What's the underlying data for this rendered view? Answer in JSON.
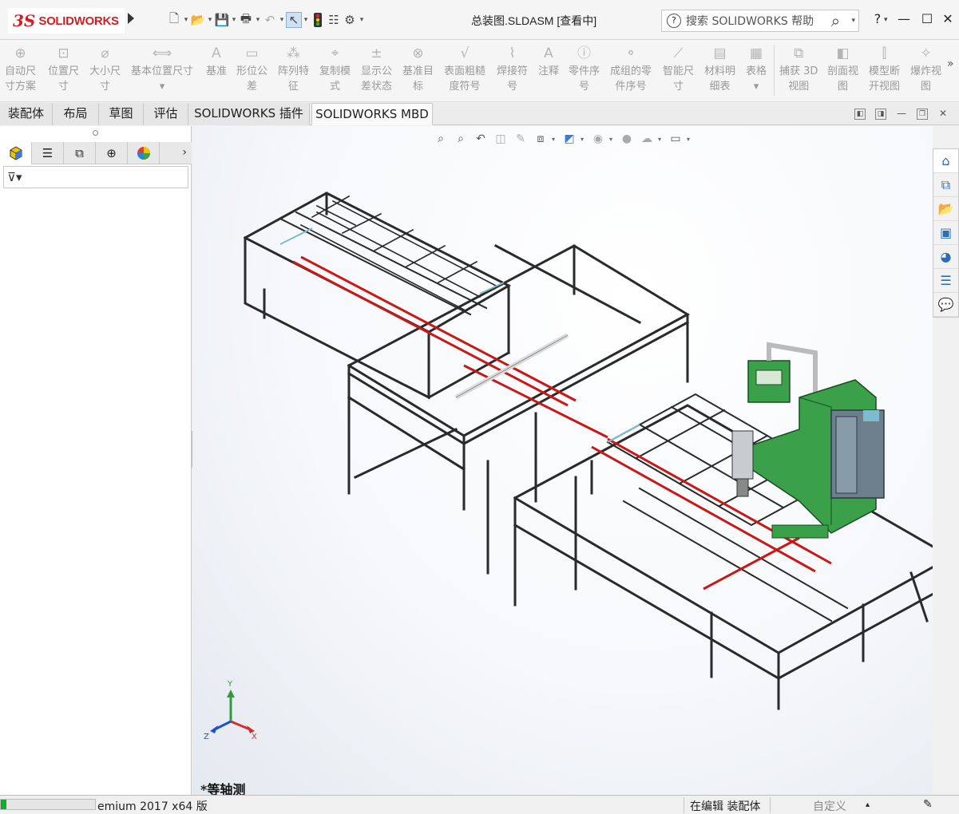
{
  "app": {
    "brand": "SOLIDWORKS",
    "brand_mark": "3S",
    "document_title": "总装图.SLDASM [查看中]"
  },
  "search": {
    "placeholder": "搜索 SOLIDWORKS 帮助",
    "help_mark": "?"
  },
  "window_buttons": [
    "?",
    "—",
    "☐",
    "✕"
  ],
  "quick_access": [
    {
      "icon": "new-document-icon",
      "glyph": "🗋"
    },
    {
      "icon": "open-folder-icon",
      "glyph": "📂"
    },
    {
      "icon": "save-icon",
      "glyph": "💾"
    },
    {
      "icon": "print-icon",
      "glyph": "🖶"
    },
    {
      "icon": "undo-icon",
      "glyph": "↶"
    },
    {
      "icon": "select-pointer-icon",
      "glyph": "↖"
    },
    {
      "icon": "rebuild-traffic-light-icon",
      "glyph": "🚦"
    },
    {
      "icon": "file-properties-icon",
      "glyph": "☷"
    },
    {
      "icon": "options-gear-icon",
      "glyph": "⚙"
    }
  ],
  "ribbon": {
    "items": [
      {
        "label_1": "自动尺",
        "label_2": "寸方案",
        "icon": "auto-dimension-icon",
        "glyph": "⊕"
      },
      {
        "label_1": "位置尺",
        "label_2": "寸",
        "icon": "location-dimension-icon",
        "glyph": "⊡"
      },
      {
        "label_1": "大小尺",
        "label_2": "寸",
        "icon": "size-dimension-icon",
        "glyph": "⌀"
      },
      {
        "label_1": "基本位置尺寸",
        "label_2": "▾",
        "icon": "basic-location-icon",
        "glyph": "⟺"
      },
      {
        "label_1": "基准",
        "label_2": "",
        "icon": "datum-icon",
        "glyph": "Ａ"
      },
      {
        "label_1": "形位公",
        "label_2": "差",
        "icon": "gtol-icon",
        "glyph": "▭"
      },
      {
        "label_1": "阵列特",
        "label_2": "征",
        "icon": "pattern-feature-icon",
        "glyph": "⁂"
      },
      {
        "label_1": "复制模",
        "label_2": "式",
        "icon": "copy-scheme-icon",
        "glyph": "⌖"
      },
      {
        "label_1": "显示公",
        "label_2": "差状态",
        "icon": "tolerance-status-icon",
        "glyph": "±"
      },
      {
        "label_1": "基准目",
        "label_2": "标",
        "icon": "datum-target-icon",
        "glyph": "⊗"
      },
      {
        "label_1": "表面粗糙",
        "label_2": "度符号",
        "icon": "surface-finish-icon",
        "glyph": "√"
      },
      {
        "label_1": "焊接符",
        "label_2": "号",
        "icon": "weld-symbol-icon",
        "glyph": "⌇"
      },
      {
        "label_1": "注释",
        "label_2": "",
        "icon": "note-icon",
        "glyph": "A"
      },
      {
        "label_1": "零件序",
        "label_2": "号",
        "icon": "balloon-icon",
        "glyph": "ⓘ"
      },
      {
        "label_1": "成组的零",
        "label_2": "件序号",
        "icon": "stacked-balloon-icon",
        "glyph": "⚬"
      },
      {
        "label_1": "智能尺",
        "label_2": "寸",
        "icon": "smart-dimension-icon",
        "glyph": "⟋"
      },
      {
        "label_1": "材料明",
        "label_2": "细表",
        "icon": "bom-icon",
        "glyph": "▤"
      },
      {
        "label_1": "表格",
        "label_2": "▾",
        "icon": "table-icon",
        "glyph": "▦"
      },
      {
        "label_1": "捕获 3D",
        "label_2": "视图",
        "icon": "capture-3d-view-icon",
        "glyph": "⧉"
      },
      {
        "label_1": "剖面视",
        "label_2": "图",
        "icon": "section-view-icon",
        "glyph": "◧"
      },
      {
        "label_1": "模型断",
        "label_2": "开视图",
        "icon": "model-break-view-icon",
        "glyph": "⫿"
      },
      {
        "label_1": "爆炸视",
        "label_2": "图",
        "icon": "exploded-view-icon",
        "glyph": "✧"
      }
    ],
    "more": "»"
  },
  "tabs": [
    "装配体",
    "布局",
    "草图",
    "评估",
    "SOLIDWORKS 插件",
    "SOLIDWORKS MBD"
  ],
  "active_tab": "SOLIDWORKS MBD",
  "panel_tabs": [
    {
      "icon": "feature-manager-icon",
      "glyph": "🧊"
    },
    {
      "icon": "property-manager-icon",
      "glyph": "☰"
    },
    {
      "icon": "configuration-manager-icon",
      "glyph": "⧉"
    },
    {
      "icon": "dimxpert-manager-icon",
      "glyph": "⊕"
    },
    {
      "icon": "display-manager-icon",
      "glyph": "◕"
    }
  ],
  "panel_more": "›",
  "filter": {
    "glyph": "⊽▾"
  },
  "view_hud": [
    {
      "icon": "zoom-to-fit-icon",
      "glyph": "⌕"
    },
    {
      "icon": "zoom-to-area-icon",
      "glyph": "⌕"
    },
    {
      "icon": "previous-view-icon",
      "glyph": "↶"
    },
    {
      "icon": "section-view-hud-icon",
      "glyph": "◫"
    },
    {
      "icon": "dynamic-annotation-icon",
      "glyph": "✎"
    },
    {
      "icon": "view-orientation-icon",
      "glyph": "⧈"
    },
    {
      "icon": "display-style-icon",
      "glyph": "◩"
    },
    {
      "icon": "hide-show-items-icon",
      "glyph": "◉"
    },
    {
      "icon": "edit-appearance-icon",
      "glyph": "●"
    },
    {
      "icon": "apply-scene-icon",
      "glyph": "☁"
    },
    {
      "icon": "view-settings-icon",
      "glyph": "▭"
    }
  ],
  "view_label": "*等轴测",
  "triad": {
    "x": "X",
    "y": "Y",
    "z": "Z"
  },
  "task_pane": [
    {
      "icon": "home-icon",
      "glyph": "⌂"
    },
    {
      "icon": "design-library-icon",
      "glyph": "⧉"
    },
    {
      "icon": "file-explorer-icon",
      "glyph": "📂"
    },
    {
      "icon": "view-palette-icon",
      "glyph": "▣"
    },
    {
      "icon": "appearances-icon",
      "glyph": "◕"
    },
    {
      "icon": "custom-properties-icon",
      "glyph": "☰"
    },
    {
      "icon": "forum-icon",
      "glyph": "💬"
    }
  ],
  "status": {
    "product": "emium 2017 x64 版",
    "mode": "在编辑 装配体",
    "units": "自定义",
    "progress_fraction": 0.06,
    "progress_color": "#06b025"
  },
  "model_colors": {
    "frame": "#2a2a2a",
    "rail": "#c81818",
    "machine": "#3aa04a",
    "cabinet": "#6d7f8c",
    "highlight": "#7dbcd0"
  }
}
